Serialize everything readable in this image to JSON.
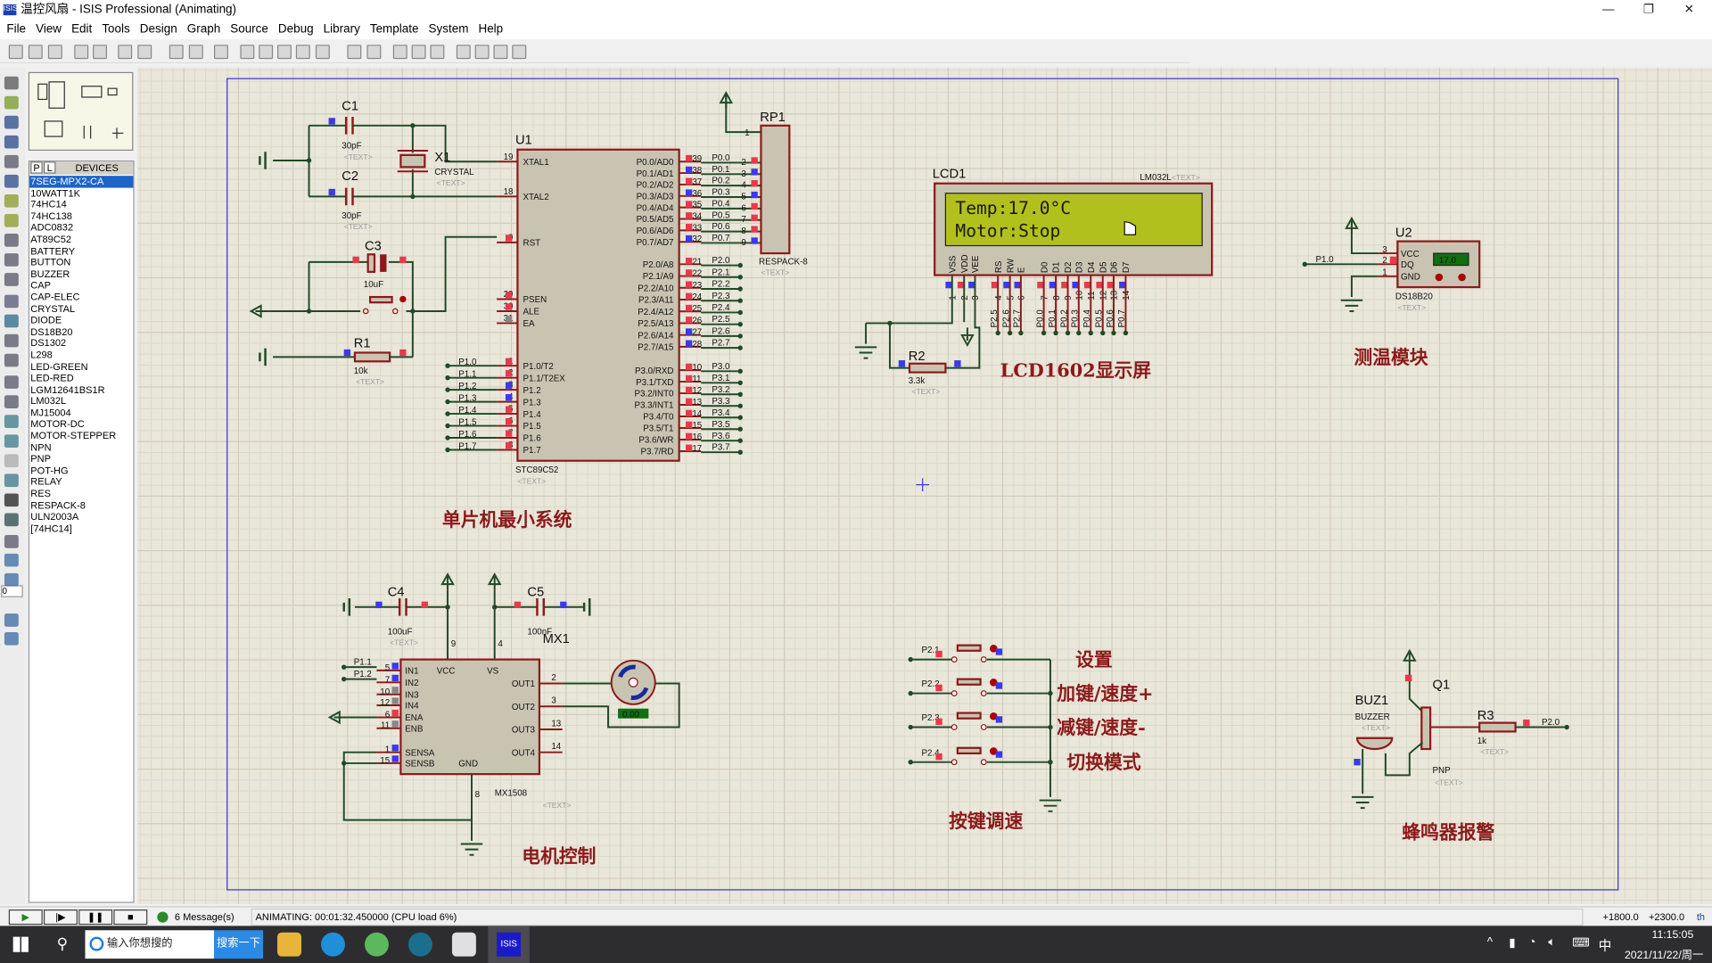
{
  "window": {
    "title": "温控风扇 - ISIS Professional (Animating)",
    "app_icon": "ISIS",
    "minimize": "—",
    "maximize": "❐",
    "close": "✕"
  },
  "menu": [
    "File",
    "View",
    "Edit",
    "Tools",
    "Design",
    "Graph",
    "Source",
    "Debug",
    "Library",
    "Template",
    "System",
    "Help"
  ],
  "devices": {
    "tab_p": "P",
    "tab_l": "L",
    "header": "DEVICES",
    "selected_index": 0,
    "items": [
      "7SEG-MPX2-CA",
      "10WATT1K",
      "74HC14",
      "74HC138",
      "ADC0832",
      "AT89C52",
      "BATTERY",
      "BUTTON",
      "BUZZER",
      "CAP",
      "CAP-ELEC",
      "CRYSTAL",
      "DIODE",
      "DS18B20",
      "DS1302",
      "L298",
      "LED-GREEN",
      "LED-RED",
      "LGM12641BS1R",
      "LM032L",
      "MJ15004",
      "MOTOR-DC",
      "MOTOR-STEPPER",
      "NPN",
      "PNP",
      "POT-HG",
      "RELAY",
      "RES",
      "RESPACK-8",
      "ULN2003A",
      "[74HC14]"
    ]
  },
  "rotation_value": "0",
  "schematic": {
    "text_placeholder": "<TEXT>",
    "sections": {
      "mcu": "单片机最小系统",
      "lcd": "LCD1602显示屏",
      "temp": "测温模块",
      "motor": "电机控制",
      "keys": "按键调速",
      "buzzer": "蜂鸣器报警"
    },
    "crystal": {
      "c1_ref": "C1",
      "c1_value": "30pF",
      "c2_ref": "C2",
      "c2_value": "30pF",
      "x1_ref": "X1",
      "x1_value": "CRYSTAL",
      "c3_ref": "C3",
      "c3_value": "10uF",
      "r1_ref": "R1",
      "r1_value": "10k"
    },
    "mcu": {
      "ref": "U1",
      "part": "STC89C52",
      "left_pins": [
        {
          "name": "XTAL1",
          "num": "19"
        },
        {
          "name": "XTAL2",
          "num": "18"
        },
        {
          "name": "RST",
          "num": "9"
        },
        {
          "name": "PSEN",
          "num": "29"
        },
        {
          "name": "ALE",
          "num": "30"
        },
        {
          "name": "EA",
          "num": "31"
        },
        {
          "name": "P1.0/T2",
          "num": "1"
        },
        {
          "name": "P1.1/T2EX",
          "num": "2"
        },
        {
          "name": "P1.2",
          "num": "3"
        },
        {
          "name": "P1.3",
          "num": "4"
        },
        {
          "name": "P1.4",
          "num": "5"
        },
        {
          "name": "P1.5",
          "num": "6"
        },
        {
          "name": "P1.6",
          "num": "7"
        },
        {
          "name": "P1.7",
          "num": "8"
        }
      ],
      "p1_nets": [
        "P1.0",
        "P1.1",
        "P1.2",
        "P1.3",
        "P1.4",
        "P1.5",
        "P1.6",
        "P1.7"
      ],
      "right_pins": [
        {
          "name": "P0.0/AD0",
          "num": "39",
          "net": "P0.0"
        },
        {
          "name": "P0.1/AD1",
          "num": "38",
          "net": "P0.1"
        },
        {
          "name": "P0.2/AD2",
          "num": "37",
          "net": "P0.2"
        },
        {
          "name": "P0.3/AD3",
          "num": "36",
          "net": "P0.3"
        },
        {
          "name": "P0.4/AD4",
          "num": "35",
          "net": "P0.4"
        },
        {
          "name": "P0.5/AD5",
          "num": "34",
          "net": "P0.5"
        },
        {
          "name": "P0.6/AD6",
          "num": "33",
          "net": "P0.6"
        },
        {
          "name": "P0.7/AD7",
          "num": "32",
          "net": "P0.7"
        },
        {
          "name": "P2.0/A8",
          "num": "21",
          "net": "P2.0"
        },
        {
          "name": "P2.1/A9",
          "num": "22",
          "net": "P2.1"
        },
        {
          "name": "P2.2/A10",
          "num": "23",
          "net": "P2.2"
        },
        {
          "name": "P2.3/A11",
          "num": "24",
          "net": "P2.3"
        },
        {
          "name": "P2.4/A12",
          "num": "25",
          "net": "P2.4"
        },
        {
          "name": "P2.5/A13",
          "num": "26",
          "net": "P2.5"
        },
        {
          "name": "P2.6/A14",
          "num": "27",
          "net": "P2.6"
        },
        {
          "name": "P2.7/A15",
          "num": "28",
          "net": "P2.7"
        },
        {
          "name": "P3.0/RXD",
          "num": "10",
          "net": "P3.0"
        },
        {
          "name": "P3.1/TXD",
          "num": "11",
          "net": "P3.1"
        },
        {
          "name": "P3.2/INT0",
          "num": "12",
          "net": "P3.2"
        },
        {
          "name": "P3.3/INT1",
          "num": "13",
          "net": "P3.3"
        },
        {
          "name": "P3.4/T0",
          "num": "14",
          "net": "P3.4"
        },
        {
          "name": "P3.5/T1",
          "num": "15",
          "net": "P3.5"
        },
        {
          "name": "P3.6/WR",
          "num": "16",
          "net": "P3.6"
        },
        {
          "name": "P3.7/RD",
          "num": "17",
          "net": "P3.7"
        }
      ],
      "rp1": {
        "ref": "RP1",
        "part": "RESPACK-8",
        "pin_one": "1",
        "pins": [
          "2",
          "3",
          "4",
          "5",
          "6",
          "7",
          "8",
          "9"
        ]
      }
    },
    "lcd": {
      "ref": "LCD1",
      "part": "LM032L",
      "line1": "Temp:17.0°C",
      "line2": "Motor:Stop",
      "pins": [
        {
          "name": "VSS",
          "num": "1"
        },
        {
          "name": "VDD",
          "num": "2"
        },
        {
          "name": "VEE",
          "num": "3"
        },
        {
          "name": "RS",
          "num": "4",
          "net": "P2.5"
        },
        {
          "name": "RW",
          "num": "5",
          "net": "P2.6"
        },
        {
          "name": "E",
          "num": "6",
          "net": "P2.7"
        },
        {
          "name": "D0",
          "num": "7",
          "net": "P0.0"
        },
        {
          "name": "D1",
          "num": "8",
          "net": "P0.1"
        },
        {
          "name": "D2",
          "num": "9",
          "net": "P0.2"
        },
        {
          "name": "D3",
          "num": "10",
          "net": "P0.3"
        },
        {
          "name": "D4",
          "num": "11",
          "net": "P0.4"
        },
        {
          "name": "D5",
          "num": "12",
          "net": "P0.5"
        },
        {
          "name": "D6",
          "num": "13",
          "net": "P0.6"
        },
        {
          "name": "D7",
          "num": "14",
          "net": "P0.7"
        }
      ],
      "r2_ref": "R2",
      "r2_value": "3.3k"
    },
    "sensor": {
      "ref": "U2",
      "part": "DS18B20",
      "readout": "17.0",
      "net": "P1.0",
      "pins": [
        {
          "name": "VCC",
          "num": "3"
        },
        {
          "name": "DQ",
          "num": "2"
        },
        {
          "name": "GND",
          "num": "1"
        }
      ]
    },
    "motor": {
      "c4_ref": "C4",
      "c4_value": "100uF",
      "c5_ref": "C5",
      "c5_value": "100nF",
      "motor_ref": "MX1",
      "motor_readout": "0.00",
      "driver_part": "MX1508",
      "vcc": "VCC",
      "vs": "VS",
      "gnd": "GND",
      "vcc_num": "9",
      "vs_num": "4",
      "gnd_num": "8",
      "in_pins": [
        {
          "name": "IN1",
          "num": "5",
          "net": "P1.1"
        },
        {
          "name": "IN2",
          "num": "7",
          "net": "P1.2"
        },
        {
          "name": "IN3",
          "num": "10"
        },
        {
          "name": "IN4",
          "num": "12"
        },
        {
          "name": "ENA",
          "num": "6"
        },
        {
          "name": "ENB",
          "num": "11"
        },
        {
          "name": "SENSA",
          "num": "1"
        },
        {
          "name": "SENSB",
          "num": "15"
        }
      ],
      "out_pins": [
        {
          "name": "OUT1",
          "num": "2"
        },
        {
          "name": "OUT2",
          "num": "3"
        },
        {
          "name": "OUT3",
          "num": "13"
        },
        {
          "name": "OUT4",
          "num": "14"
        }
      ]
    },
    "keys": [
      {
        "net": "P2.1",
        "label": "设置"
      },
      {
        "net": "P2.2",
        "label": "加键/速度+"
      },
      {
        "net": "P2.3",
        "label": "减键/速度-"
      },
      {
        "net": "P2.4",
        "label": "切换模式"
      }
    ],
    "buzzer": {
      "buz_ref": "BUZ1",
      "buz_part": "BUZZER",
      "q_ref": "Q1",
      "q_part": "PNP",
      "r3_ref": "R3",
      "r3_value": "1k",
      "net": "P2.0"
    }
  },
  "status": {
    "messages": "6 Message(s)",
    "text": "ANIMATING: 00:01:32.450000 (CPU load 6%)",
    "x": "+1800.0",
    "y": "+2300.0",
    "unit": "th"
  },
  "taskbar": {
    "search_placeholder": "输入你想搜的",
    "search_button": "搜索一下",
    "ime": "中",
    "time": "11:15:05",
    "date": "2021/11/22/周一",
    "active_app": "ISIS"
  }
}
